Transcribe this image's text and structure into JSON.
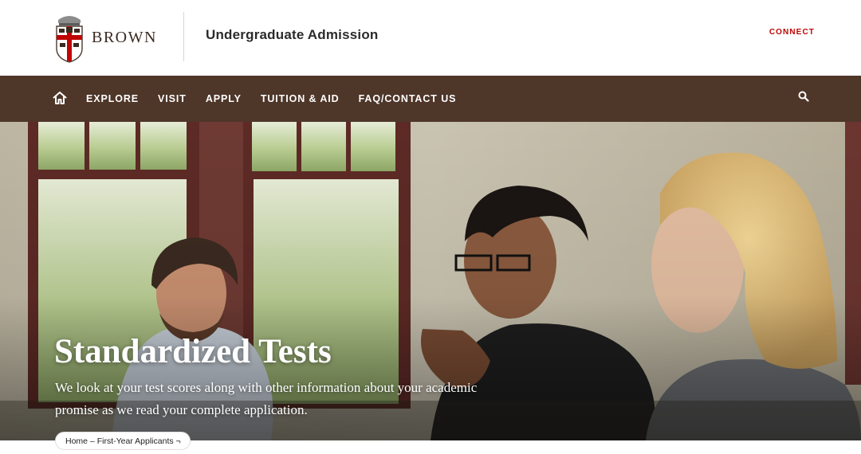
{
  "header": {
    "logo_text": "BROWN",
    "site_title": "Undergraduate Admission",
    "connect_label": "CONNECT"
  },
  "nav": {
    "home_icon": "home-icon",
    "items": [
      "EXPLORE",
      "VISIT",
      "APPLY",
      "TUITION & AID",
      "FAQ/CONTACT US"
    ],
    "search_icon": "search-icon"
  },
  "hero": {
    "title": "Standardized Tests",
    "subtitle": "We look at your test scores along with other information about your academic promise as we read your complete application."
  },
  "breadcrumb": {
    "items": [
      "Home",
      "First-Year Applicants"
    ],
    "separator": " – ",
    "expand_glyph": " ¬"
  },
  "colors": {
    "nav_background": "#4e3629",
    "accent_red": "#c00404",
    "text_dark": "#2b2b2b"
  }
}
